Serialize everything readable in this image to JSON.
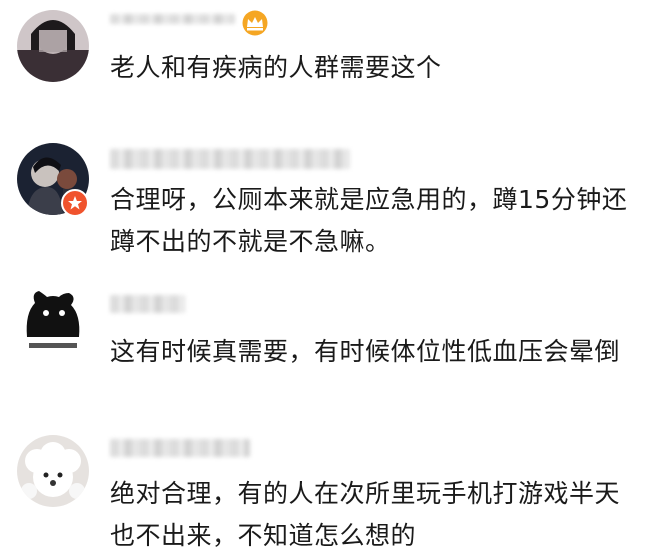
{
  "comments": [
    {
      "text": "老人和有疾病的人群需要这个",
      "badge": "crown-icon"
    },
    {
      "text": "合理呀，公厕本来就是应急用的，蹲15分钟还蹲不出的不就是不急嘛。",
      "badge": "verified-icon"
    },
    {
      "text": "这有时候真需要，有时候体位性低血压会晕倒",
      "badge": ""
    },
    {
      "text": "绝对合理，有的人在次所里玩手机打游戏半天也不出来，不知道怎么想的",
      "badge": ""
    }
  ],
  "colors": {
    "text": "#1a1a1a",
    "crown": "#f5a623",
    "verified": "#f0532d",
    "name_blur": "#d9d9d9"
  }
}
